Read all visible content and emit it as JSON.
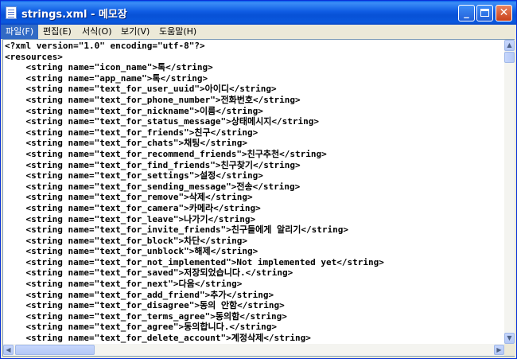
{
  "window": {
    "title": "strings.xml - 메모장"
  },
  "controls": {
    "minimize": "_",
    "close": "✕"
  },
  "menu": [
    "파일(F)",
    "편집(E)",
    "서식(O)",
    "보기(V)",
    "도움말(H)"
  ],
  "lines": [
    "<?xml version=\"1.0\" encoding=\"utf-8\"?>",
    "<resources>",
    "    <string name=\"icon_name\">톡</string>",
    "    <string name=\"app_name\">톡</string>",
    "    <string name=\"text_for_user_uuid\">아이디</string>",
    "    <string name=\"text_for_phone_number\">전화번호</string>",
    "    <string name=\"text_for_nickname\">이름</string>",
    "    <string name=\"text_for_status_message\">상태메시지</string>",
    "    <string name=\"text_for_friends\">친구</string>",
    "    <string name=\"text_for_chats\">채팅</string>",
    "    <string name=\"text_for_recommend_friends\">친구추천</string>",
    "    <string name=\"text_for_find_friends\">친구찾기</string>",
    "    <string name=\"text_for_settings\">설정</string>",
    "    <string name=\"text_for_sending_message\">전송</string>",
    "    <string name=\"text_for_remove\">삭제</string>",
    "    <string name=\"text_for_camera\">카메라</string>",
    "    <string name=\"text_for_leave\">나가기</string>",
    "    <string name=\"text_for_invite_friends\">친구들에게 알리기</string>",
    "    <string name=\"text_for_block\">차단</string>",
    "    <string name=\"text_for_unblock\">해제</string>",
    "    <string name=\"text_for_not_implemented\">Not implemented yet</string>",
    "    <string name=\"text_for_saved\">저장되었습니다.</string>",
    "    <string name=\"text_for_next\">다음</string>",
    "    <string name=\"text_for_add_friend\">추가</string>",
    "    <string name=\"text_for_disagree\">동의 안함</string>",
    "    <string name=\"text_for_terms_agree\">동의함</string>",
    "    <string name=\"text_for_agree\">동의합니다.</string>",
    "    <string name=\"text_for_delete_account\">계정삭제</string>"
  ]
}
